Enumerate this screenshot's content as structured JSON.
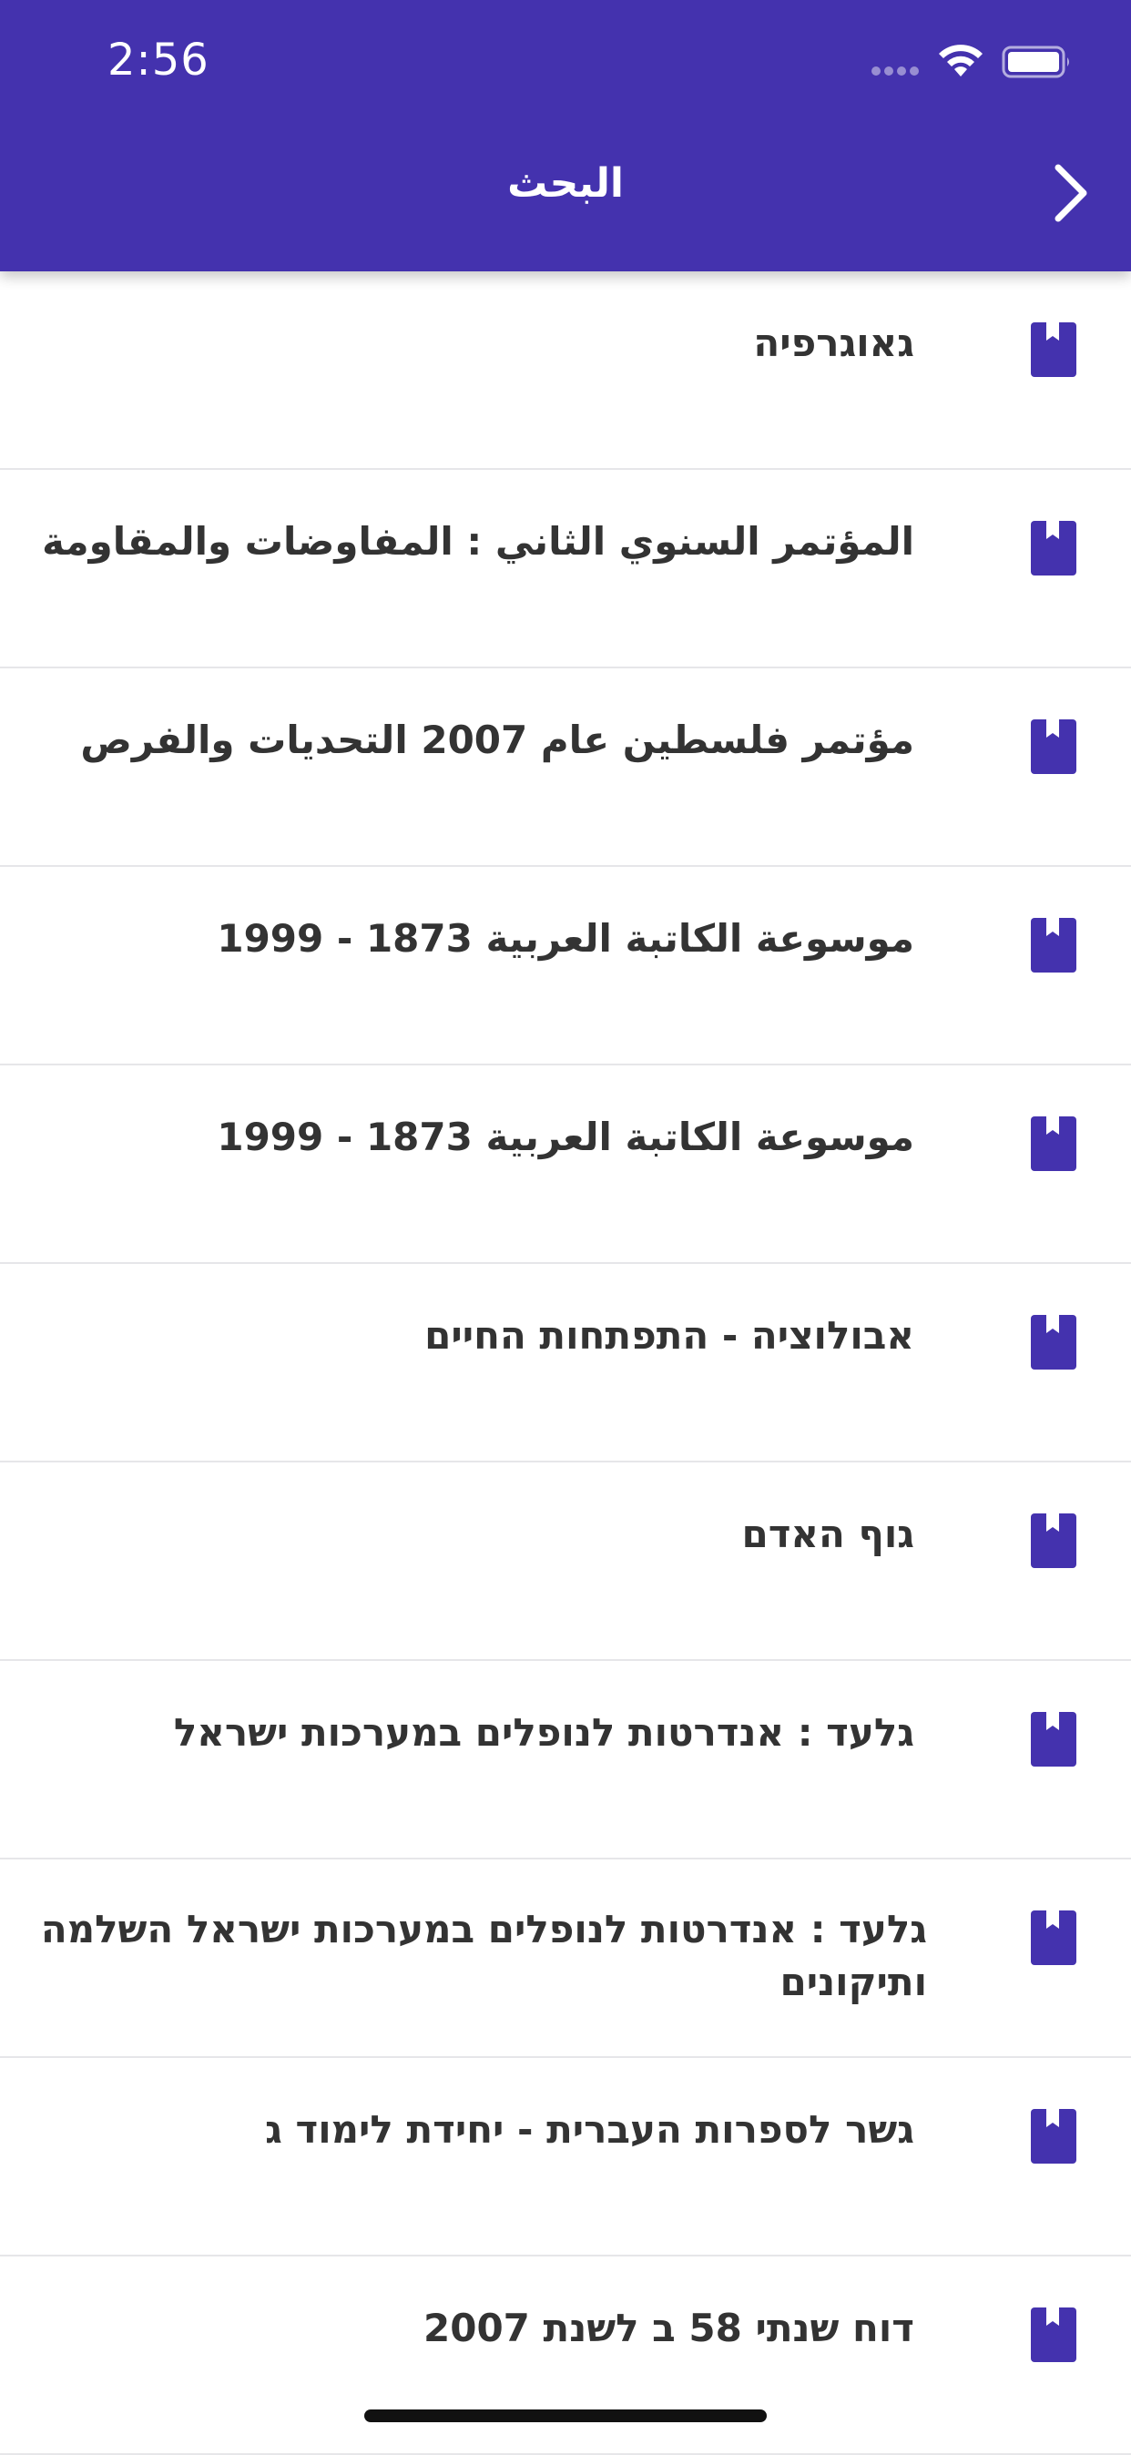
{
  "colors": {
    "header_bg": "#4432AE",
    "accent": "#4432AE",
    "text": "#333333",
    "divider": "#E6E6E9"
  },
  "status_bar": {
    "time": "2:56",
    "icons": [
      "signal-icon",
      "wifi-icon",
      "battery-icon"
    ]
  },
  "nav": {
    "title": "البحث",
    "back_icon": "chevron-right-icon"
  },
  "results": [
    {
      "title": "גאוגרפיה",
      "icon": "book-icon"
    },
    {
      "title": "المؤتمر السنوي الثاني : المفاوضات والمقاومة",
      "icon": "book-icon"
    },
    {
      "title": "مؤتمر فلسطين عام 2007 التحديات والفرص",
      "icon": "book-icon"
    },
    {
      "title": "موسوعة الكاتبة العربية 1873 - 1999",
      "icon": "book-icon"
    },
    {
      "title": "موسوعة الكاتبة العربية 1873 - 1999",
      "icon": "book-icon"
    },
    {
      "title": "אבולוציה - התפתחות החיים",
      "icon": "book-icon"
    },
    {
      "title": "גוף האדם",
      "icon": "book-icon"
    },
    {
      "title": "גלעד : אנדרטות לנופלים במערכות ישראל",
      "icon": "book-icon"
    },
    {
      "title": "גלעד : אנדרטות לנופלים במערכות ישראל השלמה ותיקונים",
      "icon": "book-icon"
    },
    {
      "title": "גשר לספרות העברית - יחידת לימוד ג",
      "icon": "book-icon"
    },
    {
      "title": "דוח שנתי 58 ב לשנת 2007",
      "icon": "book-icon"
    }
  ]
}
